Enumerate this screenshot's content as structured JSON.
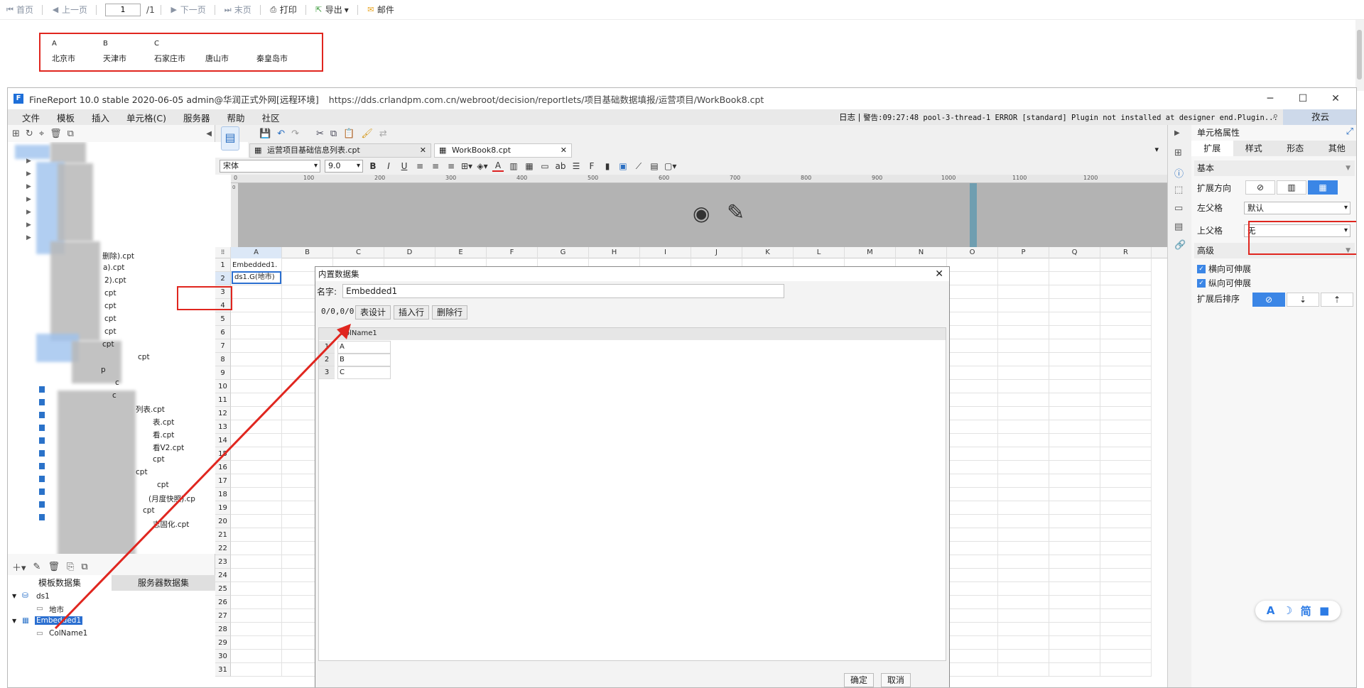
{
  "preview_toolbar": {
    "first": "首页",
    "prev": "上一页",
    "page_value": "1",
    "page_total": "/1",
    "next": "下一页",
    "last": "末页",
    "print": "打印",
    "export": "导出",
    "mail": "邮件"
  },
  "preview": {
    "headers": [
      "A",
      "B",
      "C"
    ],
    "cities": [
      "北京市",
      "天津市",
      "石家庄市",
      "唐山市",
      "秦皇岛市"
    ]
  },
  "window": {
    "title": "FineReport 10.0 stable 2020-06-05 admin@华润正式外网[远程环境]",
    "url": "https://dds.crlandpm.com.cn/webroot/decision/reportlets/项目基础数据填报/运营项目/WorkBook8.cpt"
  },
  "menu": {
    "items": [
      "文件",
      "模板",
      "插入",
      "单元格(C)",
      "服务器",
      "帮助",
      "社区"
    ],
    "log_label": "日志",
    "log_text": "警告:09:27:48 pool-3-thread-1 ERROR [standard] Plugin not installed at designer end.Plugin...",
    "user": "孜云"
  },
  "left_panel": {
    "files": [
      "删除).cpt",
      "a).cpt",
      "2).cpt",
      "cpt",
      "cpt",
      "cpt",
      "cpt",
      "cpt",
      "cpt",
      "p",
      "c",
      "c",
      "列表.cpt",
      "表.cpt",
      "看.cpt",
      "看V2.cpt",
      "cpt",
      "cpt",
      "cpt",
      "(月度快照).cp",
      "cpt",
      "志固化.cpt"
    ],
    "ds_tabs": [
      "模板数据集",
      "服务器数据集"
    ],
    "datasets": [
      {
        "name": "ds1",
        "fields": [
          "地市"
        ]
      },
      {
        "name": "Embedded1",
        "fields": [
          "ColName1"
        ]
      }
    ]
  },
  "editor": {
    "tabs": [
      "运营项目基础信息列表.cpt",
      "WorkBook8.cpt"
    ],
    "font": "宋体",
    "font_size": "9.0",
    "ruler": [
      "0",
      "100",
      "200",
      "300",
      "400",
      "500",
      "600",
      "700",
      "800",
      "900",
      "1000",
      "1100",
      "1200"
    ],
    "columns": [
      "A",
      "B",
      "C",
      "D",
      "E",
      "F",
      "G",
      "H",
      "I",
      "J",
      "K",
      "L",
      "M",
      "N",
      "O",
      "P",
      "Q",
      "R"
    ],
    "cell_a1": "Embedded1.",
    "cell_a2": "ds1.G(地市)"
  },
  "dialog": {
    "title": "内置数据集",
    "name_label": "名字:",
    "name_value": "Embedded1",
    "position": "0/0,0/0",
    "buttons": [
      "表设计",
      "插入行",
      "删除行"
    ],
    "column": "ColName1",
    "rows": [
      "A",
      "B",
      "C"
    ],
    "ok": "确定",
    "cancel": "取消"
  },
  "right_panel": {
    "title": "单元格属性",
    "tabs": [
      "扩展",
      "样式",
      "形态",
      "其他"
    ],
    "basic": "基本",
    "expand_dir": "扩展方向",
    "left_parent": "左父格",
    "left_parent_value": "默认",
    "top_parent": "上父格",
    "top_parent_value": "无",
    "advanced": "高级",
    "h_expand": "横向可伸展",
    "v_expand": "纵向可伸展",
    "sort_after": "扩展后排序"
  },
  "badge": {
    "a": "A",
    "moon": "☽",
    "simp": "简",
    "shirt": "👕"
  }
}
